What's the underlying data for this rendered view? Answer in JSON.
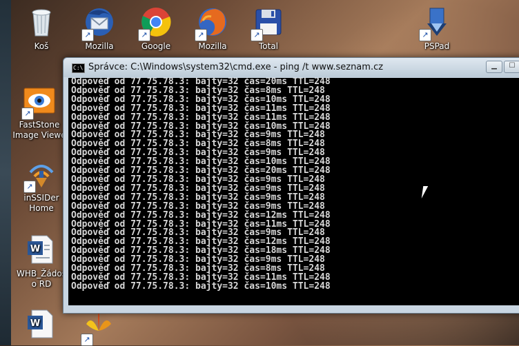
{
  "desktop": {
    "icons": [
      {
        "id": "kos",
        "label": "Koš",
        "icon": "recycle-bin-icon"
      },
      {
        "id": "thunderbird",
        "label": "Mozilla",
        "icon": "thunderbird-icon"
      },
      {
        "id": "chrome",
        "label": "Google",
        "icon": "chrome-icon"
      },
      {
        "id": "firefox",
        "label": "Mozilla",
        "icon": "firefox-icon"
      },
      {
        "id": "total",
        "label": "Total",
        "icon": "floppy-disk-icon"
      },
      {
        "id": "pspad",
        "label": "PSPad",
        "icon": "pspad-icon"
      },
      {
        "id": "faststone",
        "label": "FastStone Image Viewe",
        "icon": "faststone-icon"
      },
      {
        "id": "inssider",
        "label": "inSSIDer Home",
        "icon": "wifi-icon"
      },
      {
        "id": "whb",
        "label": "WHB_Žádos o RD",
        "icon": "word-doc-icon"
      },
      {
        "id": "word2",
        "label": "",
        "icon": "word-doc-icon"
      },
      {
        "id": "flower",
        "label": "",
        "icon": "flower-app-icon"
      }
    ]
  },
  "cmd": {
    "title": "Správce: C:\\Windows\\system32\\cmd.exe - ping  /t www.seznam.cz",
    "icon_text": "C:\\",
    "min_label": "▁",
    "max_label": "☐",
    "lines": [
      "Odpověď od 77.75.78.3: bajty=32 čas=20ms TTL=248",
      "Odpověď od 77.75.78.3: bajty=32 čas=8ms TTL=248",
      "Odpověď od 77.75.78.3: bajty=32 čas=10ms TTL=248",
      "Odpověď od 77.75.78.3: bajty=32 čas=11ms TTL=248",
      "Odpověď od 77.75.78.3: bajty=32 čas=11ms TTL=248",
      "Odpověď od 77.75.78.3: bajty=32 čas=10ms TTL=248",
      "Odpověď od 77.75.78.3: bajty=32 čas=9ms TTL=248",
      "Odpověď od 77.75.78.3: bajty=32 čas=8ms TTL=248",
      "Odpověď od 77.75.78.3: bajty=32 čas=9ms TTL=248",
      "Odpověď od 77.75.78.3: bajty=32 čas=10ms TTL=248",
      "Odpověď od 77.75.78.3: bajty=32 čas=20ms TTL=248",
      "Odpověď od 77.75.78.3: bajty=32 čas=9ms TTL=248",
      "Odpověď od 77.75.78.3: bajty=32 čas=9ms TTL=248",
      "Odpověď od 77.75.78.3: bajty=32 čas=9ms TTL=248",
      "Odpověď od 77.75.78.3: bajty=32 čas=9ms TTL=248",
      "Odpověď od 77.75.78.3: bajty=32 čas=12ms TTL=248",
      "Odpověď od 77.75.78.3: bajty=32 čas=11ms TTL=248",
      "Odpověď od 77.75.78.3: bajty=32 čas=9ms TTL=248",
      "Odpověď od 77.75.78.3: bajty=32 čas=12ms TTL=248",
      "Odpověď od 77.75.78.3: bajty=32 čas=18ms TTL=248",
      "Odpověď od 77.75.78.3: bajty=32 čas=9ms TTL=248",
      "Odpověď od 77.75.78.3: bajty=32 čas=8ms TTL=248",
      "Odpověď od 77.75.78.3: bajty=32 čas=11ms TTL=248",
      "Odpověď od 77.75.78.3: bajty=32 čas=10ms TTL=248"
    ]
  }
}
